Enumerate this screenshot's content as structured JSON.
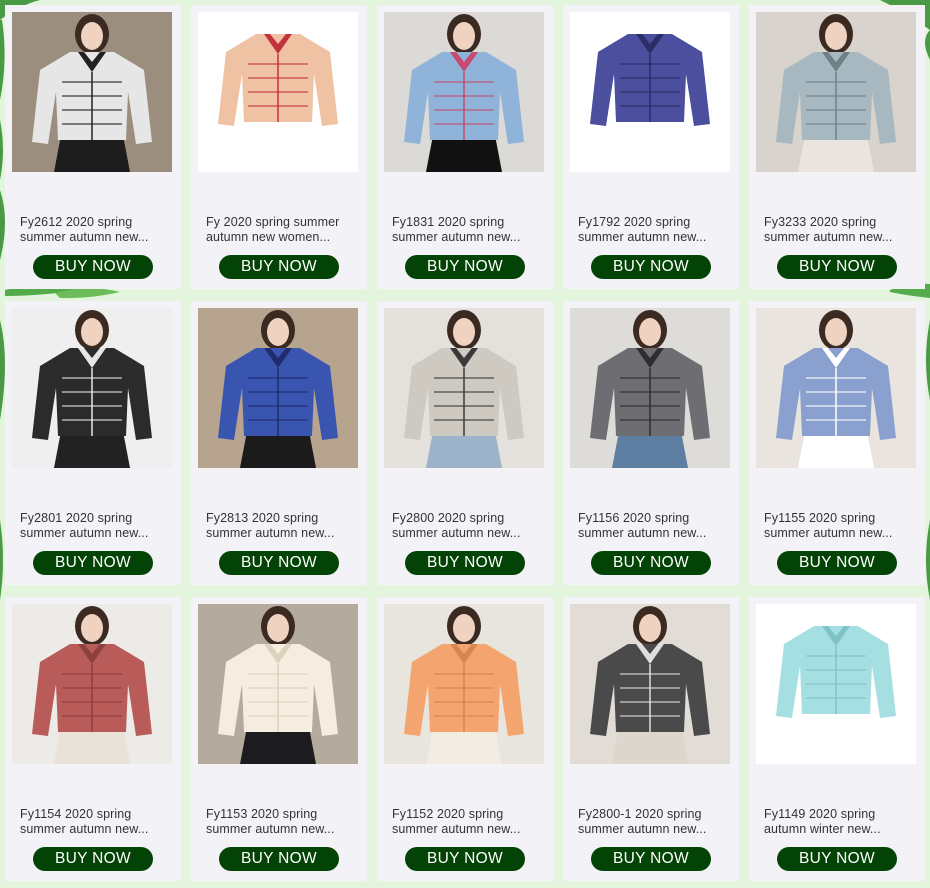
{
  "theme": {
    "background": "#e3f5dc",
    "card_background": "#f3f2f6",
    "button_color": "#034305",
    "button_text_color": "#ffffff"
  },
  "buy_label": "BUY NOW",
  "products": [
    {
      "line1": "Fy2612 2020 spring",
      "line2": "summer autumn new...",
      "bg": "#9c8e7e",
      "garment": "#e6e6e6",
      "accent": "#222222",
      "skirt": "#1d1d1d",
      "icon": "patterned-shirt-icon"
    },
    {
      "line1": "Fy 2020 spring summer",
      "line2": "autumn new women...",
      "bg": "#ffffff",
      "garment": "#f0c2a4",
      "accent": "#c2333b",
      "skirt": "",
      "icon": "floral-shirt-icon"
    },
    {
      "line1": "Fy1831 2020 spring",
      "line2": "summer autumn new...",
      "bg": "#dcdad6",
      "garment": "#8fb3d9",
      "accent": "#c94a6e",
      "skirt": "#111111",
      "icon": "denim-shirt-icon"
    },
    {
      "line1": "Fy1792 2020 spring",
      "line2": "summer autumn new...",
      "bg": "#ffffff",
      "garment": "#4b4f9e",
      "accent": "#2a2d66",
      "skirt": "",
      "icon": "plaid-shirt-icon"
    },
    {
      "line1": "Fy3233 2020 spring",
      "line2": "summer autumn new...",
      "bg": "#d8d3cc",
      "garment": "#a8b8c0",
      "accent": "#6f8088",
      "skirt": "#e9e5de",
      "icon": "striped-shirt-icon"
    },
    {
      "line1": "Fy2801 2020 spring",
      "line2": "summer autumn new...",
      "bg": "#efefef",
      "garment": "#2b2b2b",
      "accent": "#e6e6e6",
      "skirt": "#222222",
      "icon": "patterned-shirt-icon"
    },
    {
      "line1": "Fy2813 2020 spring",
      "line2": "summer autumn new...",
      "bg": "#b7a48f",
      "garment": "#3a55b0",
      "accent": "#1f2d6e",
      "skirt": "#1b1b1b",
      "icon": "plaid-shirt-icon"
    },
    {
      "line1": "Fy2800 2020 spring",
      "line2": "summer autumn new...",
      "bg": "#e4e1dc",
      "garment": "#cfcac1",
      "accent": "#3a3a3a",
      "skirt": "#9db3c9",
      "icon": "plaid-shirt-icon"
    },
    {
      "line1": "Fy1156 2020 spring",
      "line2": "summer autumn new...",
      "bg": "#dedcd8",
      "garment": "#6e6e72",
      "accent": "#2e2e31",
      "skirt": "#5d7ea0",
      "icon": "striped-shirt-icon"
    },
    {
      "line1": "Fy1155 2020 spring",
      "line2": "summer autumn new...",
      "bg": "#e9e4de",
      "garment": "#8aa0cf",
      "accent": "#ffffff",
      "skirt": "#ffffff",
      "icon": "lace-collar-shirt-icon"
    },
    {
      "line1": "Fy1154 2020 spring",
      "line2": "summer autumn new...",
      "bg": "#ecebe8",
      "garment": "#b85b59",
      "accent": "#8d3f3e",
      "skirt": "#e8e2d8",
      "icon": "wrap-shirt-icon"
    },
    {
      "line1": "Fy1153 2020 spring",
      "line2": "summer autumn new...",
      "bg": "#b4aa9e",
      "garment": "#f4ede0",
      "accent": "#ded2bd",
      "skirt": "#1c1c20",
      "icon": "blouse-icon"
    },
    {
      "line1": "Fy1152 2020 spring",
      "line2": "summer autumn new...",
      "bg": "#e8e4de",
      "garment": "#f4a46e",
      "accent": "#d9854e",
      "skirt": "#f2ede3",
      "icon": "blouse-icon"
    },
    {
      "line1": "Fy2800-1 2020 spring",
      "line2": "summer autumn new...",
      "bg": "#e1dcd6",
      "garment": "#4a4a4a",
      "accent": "#dedede",
      "skirt": "#dcd6cc",
      "icon": "plaid-shirt-icon"
    },
    {
      "line1": "Fy1149 2020 spring",
      "line2": "autumn winter new...",
      "bg": "#ffffff",
      "garment": "#a6dfe2",
      "accent": "#7fc3c8",
      "skirt": "",
      "icon": "sweater-icon"
    }
  ]
}
